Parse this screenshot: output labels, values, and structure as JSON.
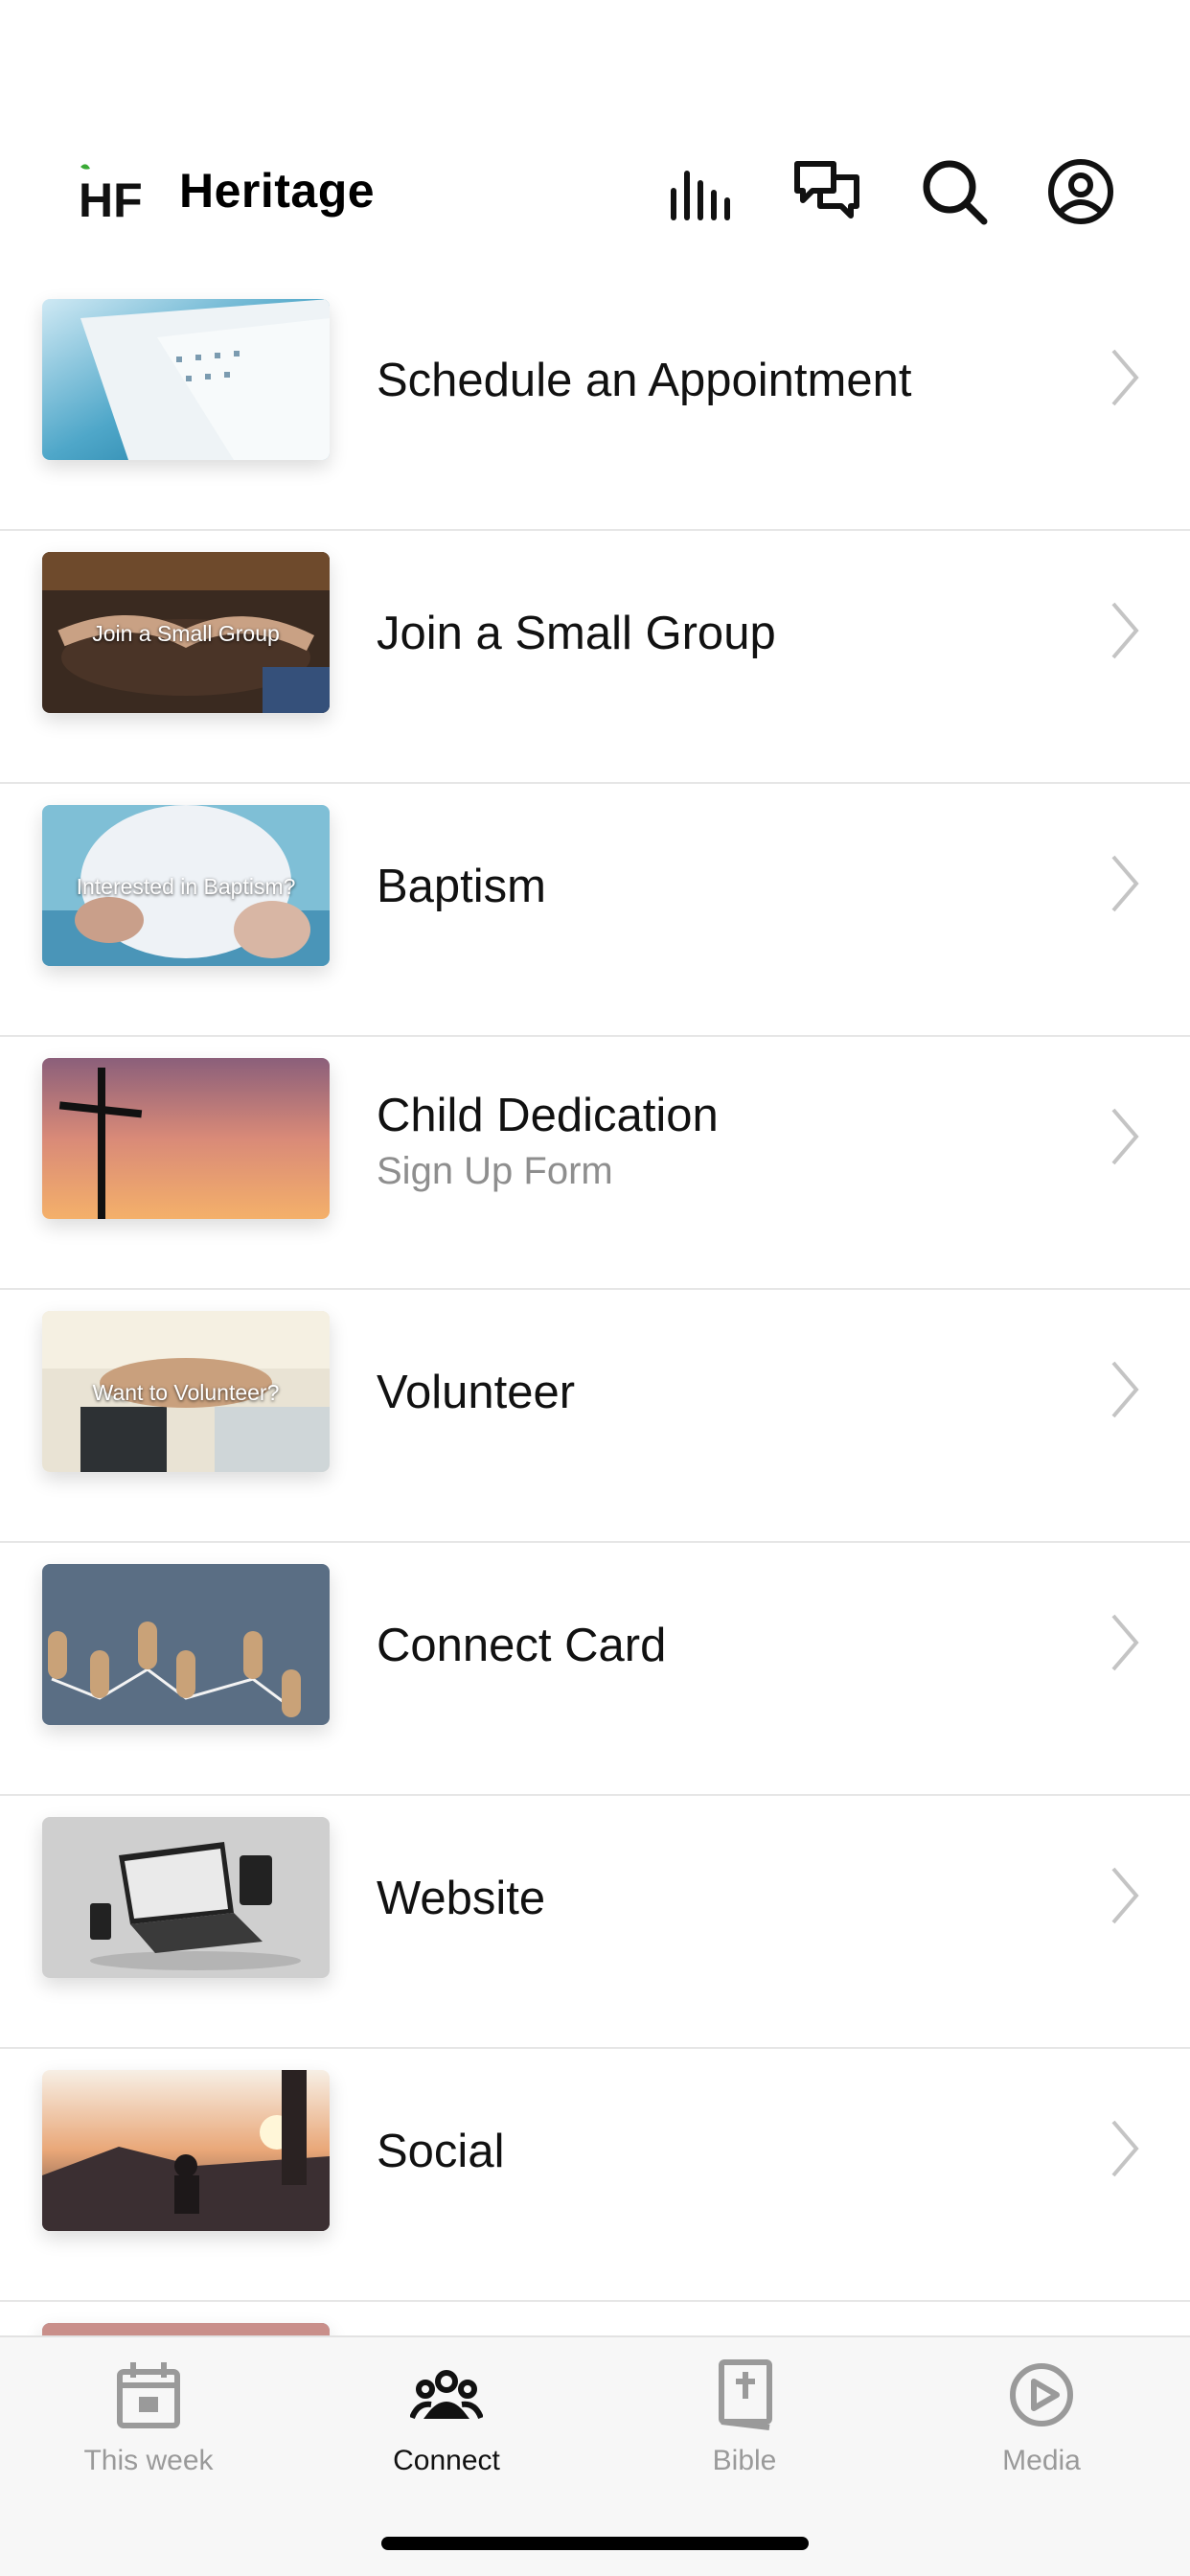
{
  "header": {
    "logo_text": "HF",
    "app_name": "Heritage",
    "icons": [
      "equalizer-icon",
      "chat-icon",
      "search-icon",
      "account-icon"
    ]
  },
  "list": {
    "items": [
      {
        "title": "Schedule an Appointment",
        "subtitle": "",
        "thumb_label": "",
        "thumb_icon": "calendar-image"
      },
      {
        "title": "Join a Small Group",
        "subtitle": "",
        "thumb_label": "Join a Small Group",
        "thumb_icon": "hands-table-image"
      },
      {
        "title": "Baptism",
        "subtitle": "",
        "thumb_label": "Interested in Baptism?",
        "thumb_icon": "baptism-image"
      },
      {
        "title": "Child Dedication",
        "subtitle": "Sign Up Form",
        "thumb_label": "",
        "thumb_icon": "cross-sunset-image"
      },
      {
        "title": "Volunteer",
        "subtitle": "",
        "thumb_label": "Want to Volunteer?",
        "thumb_icon": "stacked-hands-image"
      },
      {
        "title": "Connect Card",
        "subtitle": "",
        "thumb_label": "",
        "thumb_icon": "network-figures-image"
      },
      {
        "title": "Website",
        "subtitle": "",
        "thumb_label": "",
        "thumb_icon": "devices-image"
      },
      {
        "title": "Social",
        "subtitle": "",
        "thumb_label": "",
        "thumb_icon": "sunset-people-image"
      }
    ]
  },
  "tabbar": {
    "tabs": [
      {
        "label": "This week",
        "icon": "calendar-icon",
        "active": false
      },
      {
        "label": "Connect",
        "icon": "people-icon",
        "active": true
      },
      {
        "label": "Bible",
        "icon": "bible-icon",
        "active": false
      },
      {
        "label": "Media",
        "icon": "play-circle-icon",
        "active": false
      }
    ]
  },
  "colors": {
    "logo_leaf": "#3aaa35",
    "active_tab": "#111111",
    "inactive_tab": "#9a9a9a",
    "divider": "#e6e6e6",
    "subtitle": "#8e8e8e"
  }
}
